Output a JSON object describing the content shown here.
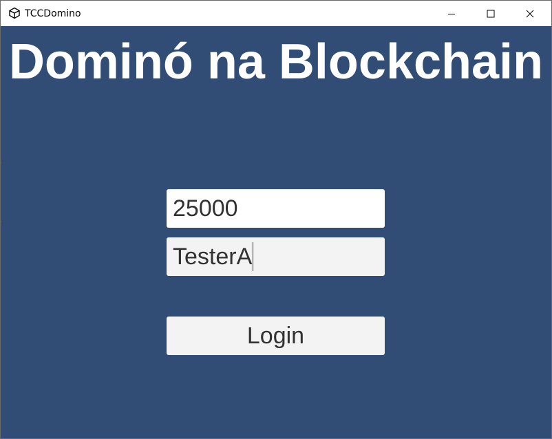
{
  "window": {
    "title": "TCCDomino",
    "controls": {
      "minimize": "minimize-icon",
      "maximize": "maximize-icon",
      "close": "close-icon"
    }
  },
  "main": {
    "heading": "Dominó na Blockchain",
    "port_field": {
      "value": "25000"
    },
    "name_field": {
      "value": "TesterA"
    },
    "login_label": "Login"
  },
  "colors": {
    "background": "#314d76",
    "heading_text": "#ffffff",
    "field_text": "#323232",
    "field_focused_bg": "#ffffff",
    "field_bg": "#f3f3f3"
  }
}
